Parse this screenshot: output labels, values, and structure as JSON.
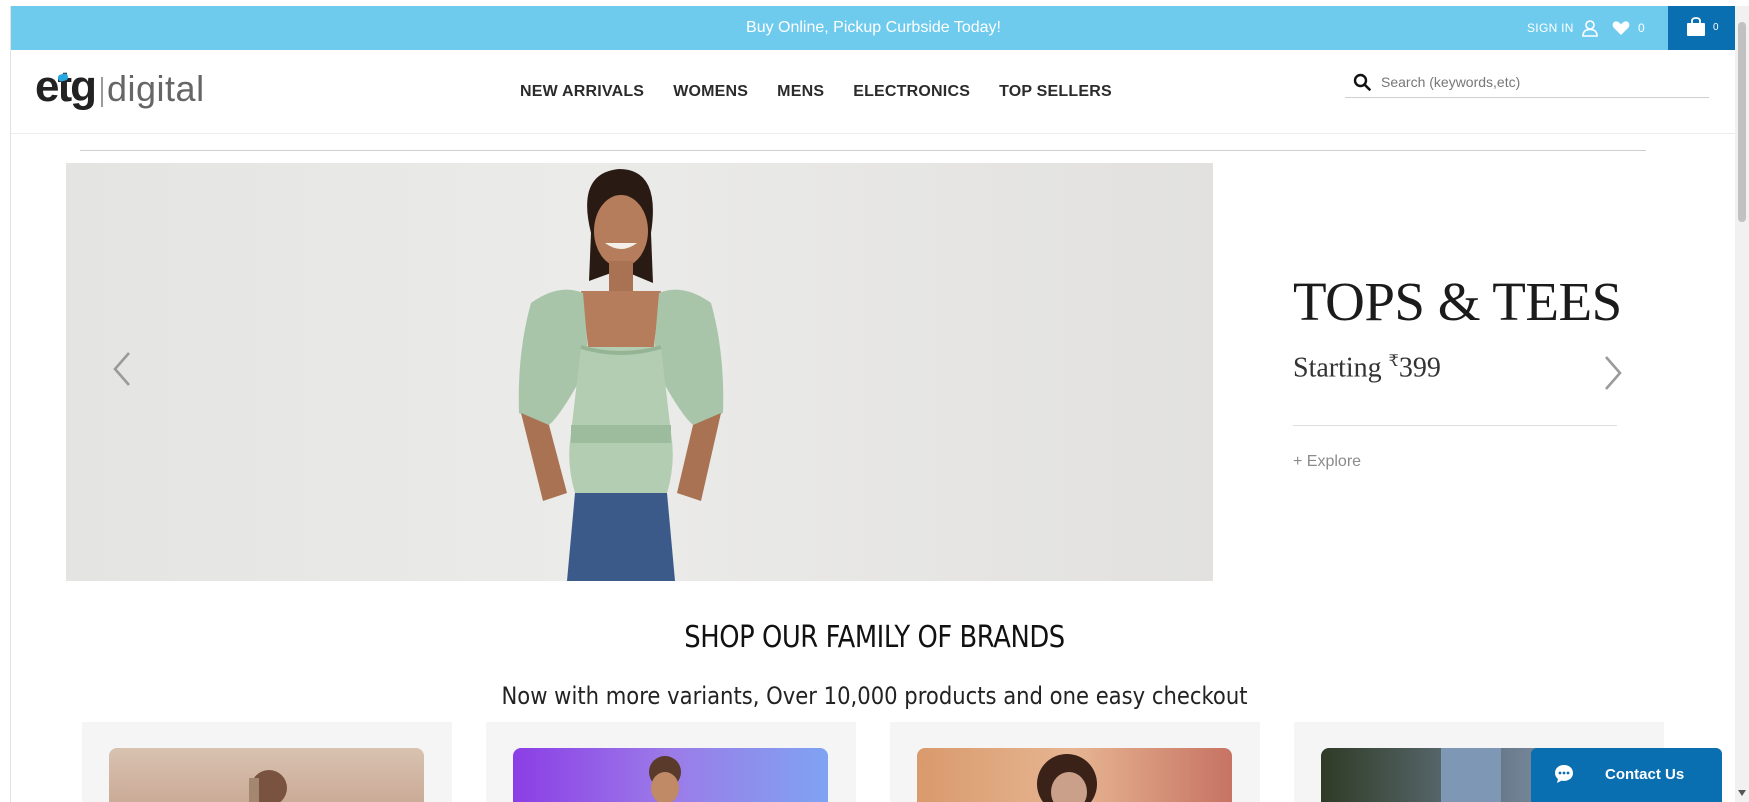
{
  "promo": {
    "text": "Buy Online, Pickup Curbside Today!",
    "sign_in": "SIGN IN",
    "wishlist_count": "0",
    "cart_count": "0",
    "bg_color": "#6ecbee",
    "cart_bg_color": "#0a6fb0"
  },
  "header": {
    "logo_brand": "etg",
    "logo_sub": "digital",
    "nav": [
      "NEW ARRIVALS",
      "WOMENS",
      "MENS",
      "ELECTRONICS",
      "TOP SELLERS"
    ],
    "search": {
      "placeholder": "Search (keywords,etc)",
      "icon": "search-icon"
    }
  },
  "hero": {
    "title": "TOPS & TEES",
    "price_prefix": "Starting ",
    "currency": "₹",
    "price": "399",
    "cta": "+ Explore",
    "prev_icon": "chevron-left-icon",
    "next_icon": "chevron-right-icon"
  },
  "brands": {
    "title": "SHOP OUR FAMILY OF BRANDS",
    "subtitle": "Now with more variants, Over 10,000 products and one easy checkout"
  },
  "contact": {
    "label": "Contact Us",
    "icon": "chat-bubble-icon"
  }
}
